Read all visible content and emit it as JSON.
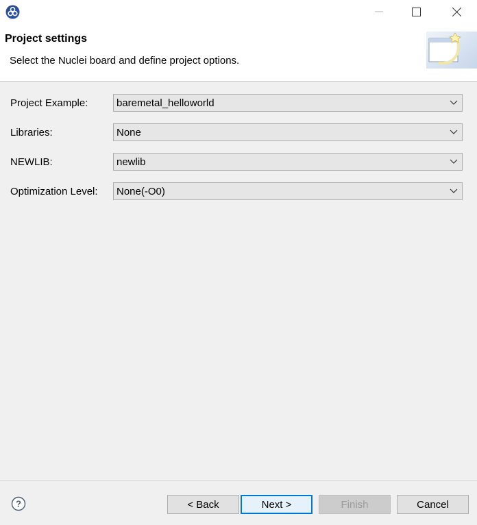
{
  "window": {
    "app_icon": "eclipse-nuclei-app-icon",
    "controls": {
      "minimize_icon": "minimize-icon",
      "maximize_icon": "maximize-icon",
      "close_icon": "close-icon"
    }
  },
  "header": {
    "title": "Project settings",
    "description": "Select the Nuclei board and define project options.",
    "image_icon": "wizard-banner-icon"
  },
  "form": {
    "fields": [
      {
        "label": "Project Example:",
        "value": "baremetal_helloworld"
      },
      {
        "label": "Libraries:",
        "value": "None"
      },
      {
        "label": "NEWLIB:",
        "value": "newlib"
      },
      {
        "label": "Optimization Level:",
        "value": "None(-O0)"
      }
    ]
  },
  "footer": {
    "help_icon": "help-icon",
    "back_label": "< Back",
    "next_label": "Next >",
    "finish_label": "Finish",
    "cancel_label": "Cancel",
    "finish_enabled": false
  },
  "colors": {
    "accent": "#0078d7",
    "header_bg": "#ffffff",
    "body_bg": "#f0f0f0",
    "combo_bg": "#e6e6e6"
  }
}
